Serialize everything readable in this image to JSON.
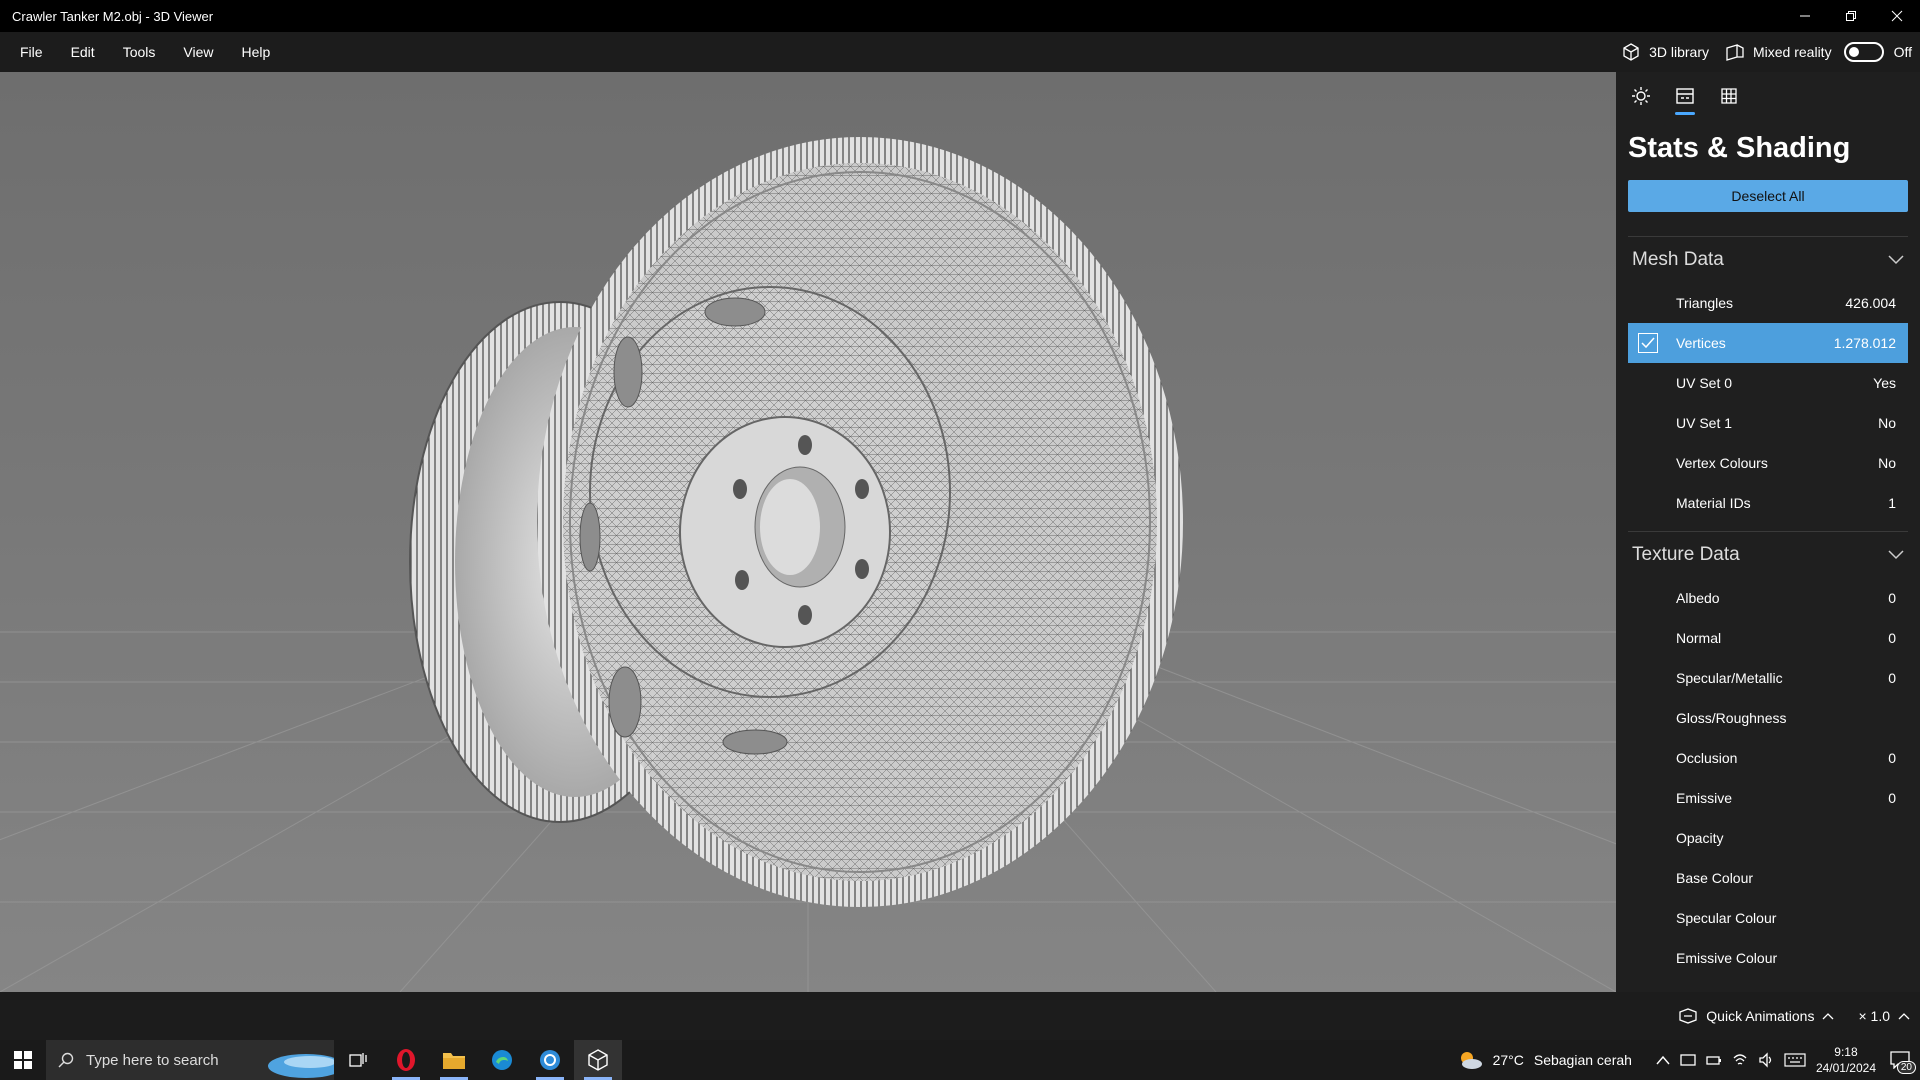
{
  "window": {
    "title": "Crawler Tanker M2.obj - 3D Viewer"
  },
  "menu": {
    "items": [
      "File",
      "Edit",
      "Tools",
      "View",
      "Help"
    ]
  },
  "topright": {
    "library_label": "3D library",
    "mixed_reality_label": "Mixed reality",
    "toggle_state": "Off"
  },
  "panel": {
    "title": "Stats & Shading",
    "deselect_label": "Deselect All",
    "mesh_section": "Mesh Data",
    "mesh_rows": [
      {
        "label": "Triangles",
        "value": "426.004"
      },
      {
        "label": "Vertices",
        "value": "1.278.012",
        "selected": true
      },
      {
        "label": "UV Set 0",
        "value": "Yes"
      },
      {
        "label": "UV Set 1",
        "value": "No"
      },
      {
        "label": "Vertex Colours",
        "value": "No"
      },
      {
        "label": "Material IDs",
        "value": "1"
      }
    ],
    "texture_section": "Texture Data",
    "texture_rows": [
      {
        "label": "Albedo",
        "value": "0"
      },
      {
        "label": "Normal",
        "value": "0"
      },
      {
        "label": "Specular/Metallic",
        "value": "0"
      },
      {
        "label": "Gloss/Roughness",
        "value": ""
      },
      {
        "label": "Occlusion",
        "value": "0"
      },
      {
        "label": "Emissive",
        "value": "0"
      },
      {
        "label": "Opacity",
        "value": ""
      },
      {
        "label": "Base Colour",
        "value": ""
      },
      {
        "label": "Specular Colour",
        "value": ""
      },
      {
        "label": "Emissive Colour",
        "value": ""
      }
    ]
  },
  "statusbar": {
    "quick_animations": "Quick Animations",
    "speed": "× 1.0"
  },
  "taskbar": {
    "search_placeholder": "Type here to search",
    "weather_temp": "27°C",
    "weather_desc": "Sebagian cerah",
    "time": "9:18",
    "date": "24/01/2024",
    "notification_count": "20"
  },
  "colors": {
    "accent": "#4d9fdd",
    "button": "#5aa9e6",
    "panel_bg": "#1f1f1f"
  }
}
